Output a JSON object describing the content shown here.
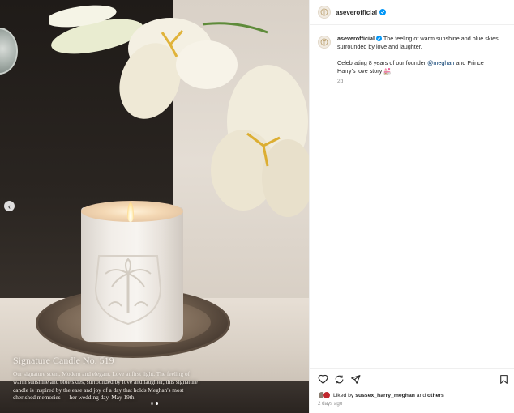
{
  "account": {
    "username": "aseverofficial",
    "verified_icon": "verified-badge-icon",
    "brand_color": "#0095f6"
  },
  "caption_overlay": {
    "title": "Signature Candle No. 519",
    "body": "Our signature scent. Modern and elegant. Love at first light. The feeling of warm sunshine and blue skies, surrounded by love and laughter, this signature candle is inspired by the ease and joy of a day that holds Meghan's most cherished memories — her wedding day, May 19th."
  },
  "post": {
    "line1": "The feeling of warm sunshine and blue skies, surrounded by love and laughter.",
    "line2_pre": "Celebrating 8 years of our founder ",
    "mention": "@meghan",
    "line2_post": " and Prince Harry's love story",
    "emoji": "💒",
    "time": "2d"
  },
  "carousel": {
    "prev_label": "‹",
    "current_index": 1,
    "total": 2
  },
  "actions": [
    "heart-icon",
    "repost-icon",
    "share-icon",
    "bookmark-icon"
  ],
  "likes": {
    "prefix": "Liked by ",
    "user": "sussex_harry_meghan",
    "middle": " and ",
    "others": "others"
  },
  "posted_ago": "2 days ago"
}
